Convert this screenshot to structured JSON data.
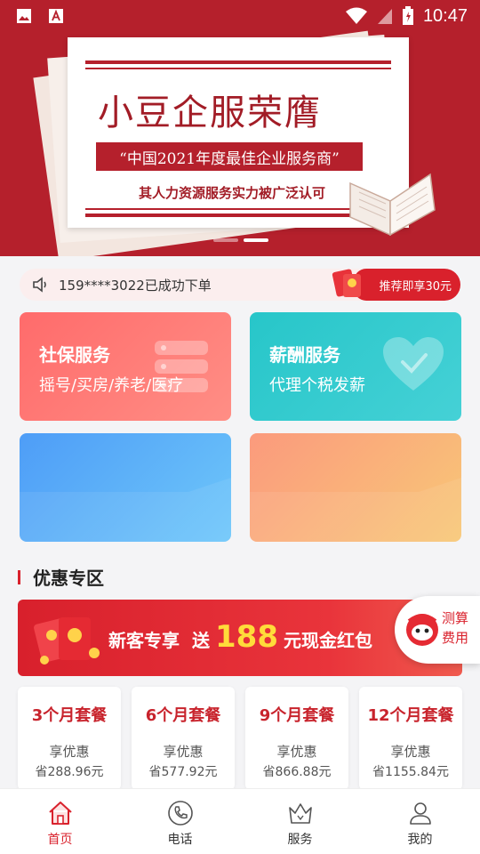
{
  "status_bar": {
    "time": "10:47"
  },
  "banner": {
    "title": "小豆企服荣膺",
    "ribbon": "“中国2021年度最佳企业服务商”",
    "subtitle": "其人力资源服务实力被广泛认可"
  },
  "notice": {
    "text": "159****3022已成功下单",
    "promo": "推荐即享30元"
  },
  "services": [
    {
      "title": "社保服务",
      "subtitle": "摇号/买房/养老/医疗"
    },
    {
      "title": "薪酬服务",
      "subtitle": "代理个税发薪"
    }
  ],
  "discount": {
    "section_title": "优惠专区",
    "promo_prefix": "新客专享",
    "promo_send": "送",
    "promo_amount": "188",
    "promo_suffix": "元现金红包",
    "calc_label": "测算费用"
  },
  "packages": [
    {
      "title": "3个月套餐",
      "label": "享优惠",
      "save": "省288.96元"
    },
    {
      "title": "6个月套餐",
      "label": "享优惠",
      "save": "省577.92元"
    },
    {
      "title": "9个月套餐",
      "label": "享优惠",
      "save": "省866.88元"
    },
    {
      "title": "12个月套餐",
      "label": "享优惠",
      "save": "省1155.84元"
    }
  ],
  "nav": [
    {
      "label": "首页",
      "icon": "home-icon",
      "active": true
    },
    {
      "label": "电话",
      "icon": "phone-icon",
      "active": false
    },
    {
      "label": "服务",
      "icon": "crown-icon",
      "active": false
    },
    {
      "label": "我的",
      "icon": "profile-icon",
      "active": false
    }
  ],
  "colors": {
    "primary_red": "#d9212c",
    "banner_red": "#b5202c",
    "teal": "#27c6c9",
    "blue": "#4e9df7",
    "orange": "#fb9a7d"
  }
}
